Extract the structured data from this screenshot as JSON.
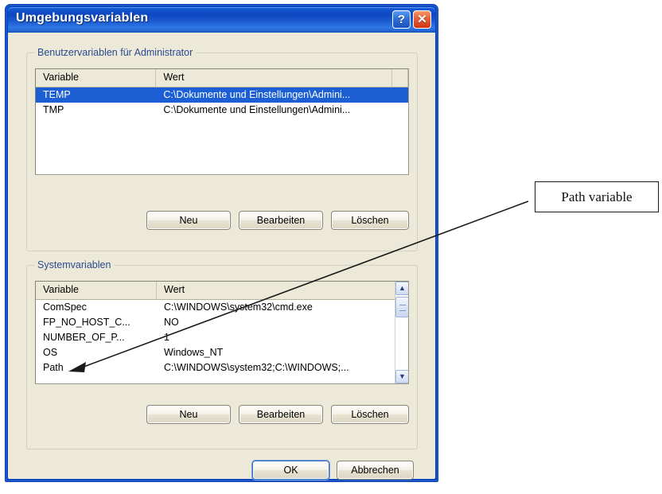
{
  "window": {
    "title": "Umgebungsvariablen",
    "help_button": "?",
    "close_button": "✕"
  },
  "user_variables": {
    "group_label": "Benutzervariablen für Administrator",
    "columns": [
      "Variable",
      "Wert"
    ],
    "rows": [
      {
        "variable": "TEMP",
        "value": "C:\\Dokumente und Einstellungen\\Admini...",
        "selected": true
      },
      {
        "variable": "TMP",
        "value": "C:\\Dokumente und Einstellungen\\Admini...",
        "selected": false
      }
    ],
    "buttons": {
      "new": "Neu",
      "edit": "Bearbeiten",
      "delete": "Löschen"
    }
  },
  "system_variables": {
    "group_label": "Systemvariablen",
    "columns": [
      "Variable",
      "Wert"
    ],
    "rows": [
      {
        "variable": "ComSpec",
        "value": "C:\\WINDOWS\\system32\\cmd.exe"
      },
      {
        "variable": "FP_NO_HOST_C...",
        "value": "NO"
      },
      {
        "variable": "NUMBER_OF_P...",
        "value": "1"
      },
      {
        "variable": "OS",
        "value": "Windows_NT"
      },
      {
        "variable": "Path",
        "value": "C:\\WINDOWS\\system32;C:\\WINDOWS;..."
      }
    ],
    "buttons": {
      "new": "Neu",
      "edit": "Bearbeiten",
      "delete": "Löschen"
    },
    "scrollbar": {
      "up": "▲",
      "down": "▼"
    }
  },
  "dialog_buttons": {
    "ok": "OK",
    "cancel": "Abbrechen"
  },
  "annotation": {
    "label": "Path variable"
  },
  "colors": {
    "titlebar_blue": "#0d47c0",
    "dialog_face": "#ece9d8",
    "selection_blue": "#1c5fd4",
    "group_label_blue": "#2a4a90",
    "close_red": "#cf3612"
  }
}
